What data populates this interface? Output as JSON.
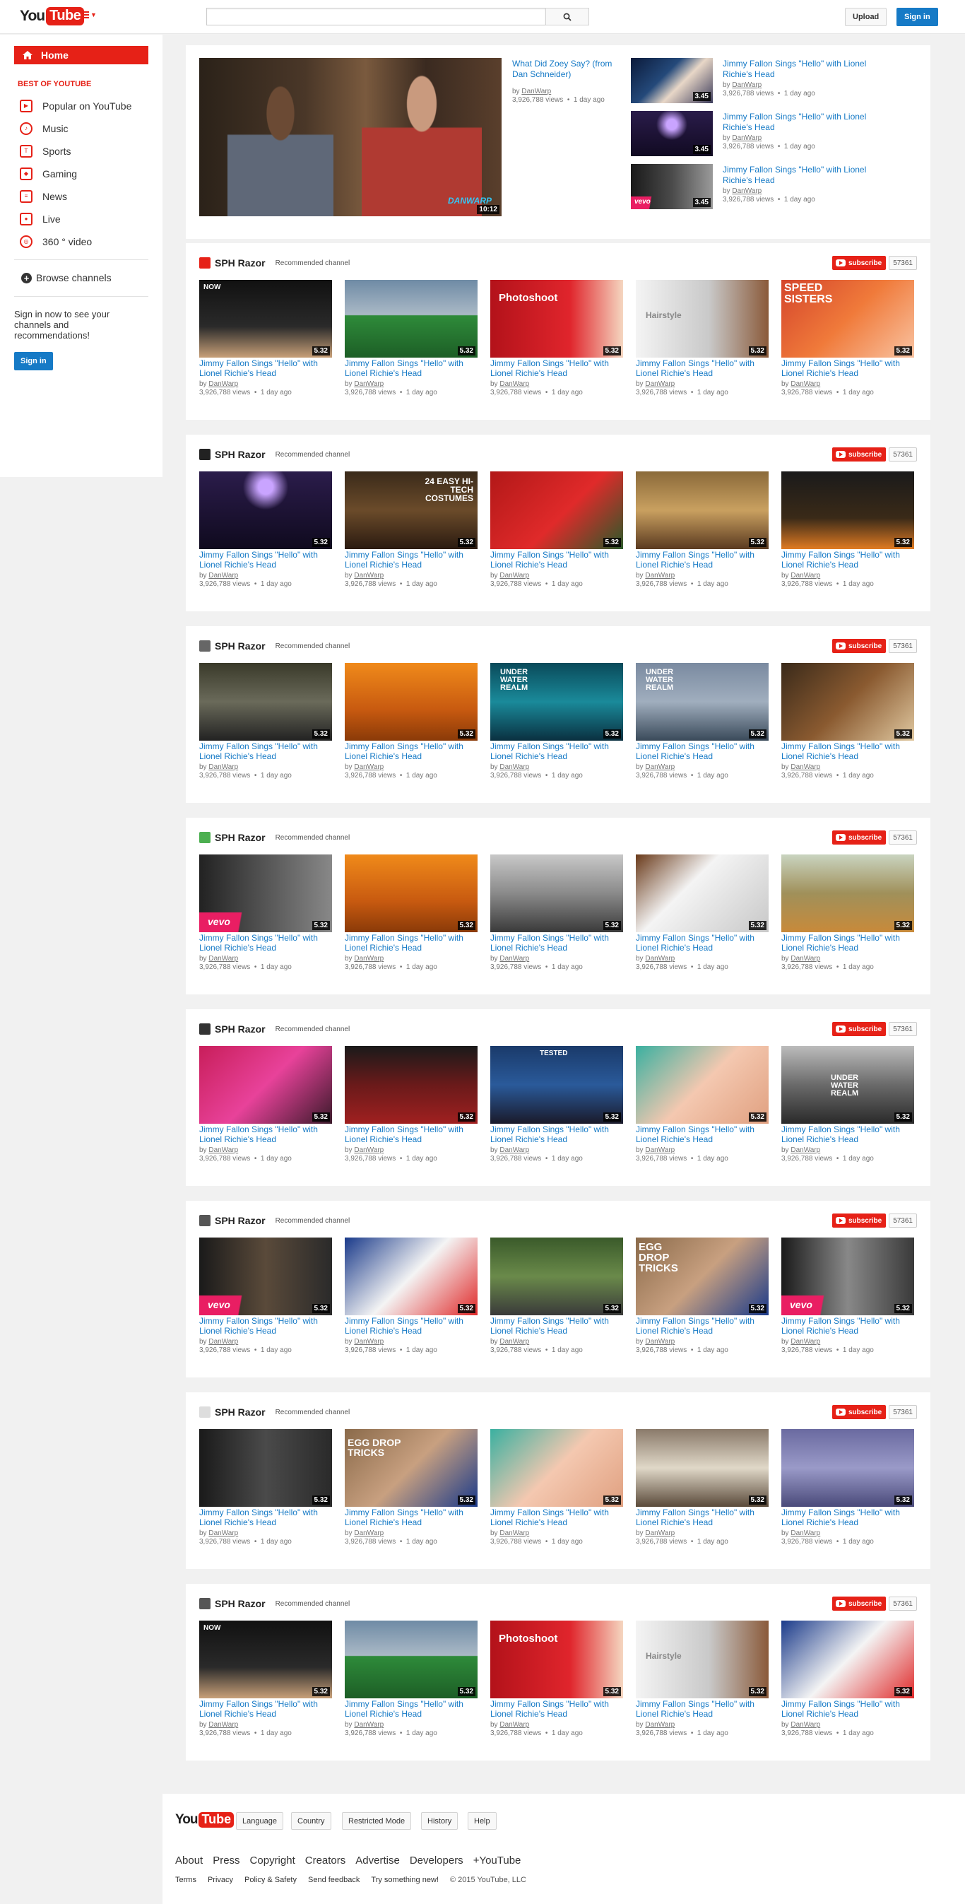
{
  "header": {
    "logo_you": "You",
    "logo_tube": "Tube",
    "search_placeholder": "",
    "upload_label": "Upload",
    "signin_label": "Sign in"
  },
  "guide": {
    "home_label": "Home",
    "section_title": "BEST OF YOUTUBE",
    "items": [
      {
        "label": "Popular on YouTube",
        "icon": "play-box-icon"
      },
      {
        "label": "Music",
        "icon": "headphones-icon"
      },
      {
        "label": "Sports",
        "icon": "trophy-icon"
      },
      {
        "label": "Gaming",
        "icon": "gamepad-icon"
      },
      {
        "label": "News",
        "icon": "newspaper-icon"
      },
      {
        "label": "Live",
        "icon": "live-icon"
      },
      {
        "label": "360 ° video",
        "icon": "360-icon"
      }
    ],
    "browse_label": "Browse channels",
    "signin_note": "Sign in now to see your channels and recommendations!",
    "signin_button": "Sign in"
  },
  "hero": {
    "title": "What Did Zoey Say? (from Dan Schneider)",
    "by_prefix": "by",
    "channel": "DanWarp",
    "views": "3,926,788 views",
    "age": "1 day ago",
    "duration": "10:12",
    "watermark": "DANWARP"
  },
  "side_videos": [
    {
      "title": "Jimmy Fallon Sings \"Hello\" with Lionel Richie's Head",
      "channel": "DanWarp",
      "views": "3,926,788 views",
      "age": "1 day ago",
      "duration": "3.45"
    },
    {
      "title": "Jimmy Fallon Sings \"Hello\" with Lionel Richie's Head",
      "channel": "DanWarp",
      "views": "3,926,788 views",
      "age": "1 day ago",
      "duration": "3.45"
    },
    {
      "title": "Jimmy Fallon Sings \"Hello\" with Lionel Richie's Head",
      "channel": "DanWarp",
      "views": "3,926,788 views",
      "age": "1 day ago",
      "duration": "3.45"
    }
  ],
  "video": {
    "title": "Jimmy Fallon Sings \"Hello\" with Lionel Richie's Head",
    "by_prefix": "by",
    "channel": "DanWarp",
    "views": "3,926,788 views",
    "age": "1 day ago",
    "duration": "5.32"
  },
  "shelf": {
    "channel_name": "SPH Razor",
    "recommended": "Recommended channel",
    "subscribe": "subscribe",
    "sub_count": "57361"
  },
  "overlays": {
    "now": "NOW",
    "photoshoot": "Photoshoot",
    "hairstyle": "Hairstyle",
    "speed_sisters": "SPEED SISTERS",
    "costumes": "24 EASY HI-TECH COSTUMES",
    "underwater": "UNDER WATER REALM",
    "vevo": "vevo",
    "egg_drop": "EGG DROP TRICKS",
    "teaser": "TESTED"
  },
  "footer": {
    "buttons": [
      "Language",
      "Country",
      "Restricted Mode",
      "History",
      "Help"
    ],
    "links": [
      "About",
      "Press",
      "Copyright",
      "Creators",
      "Advertise",
      "Developers",
      "+YouTube"
    ],
    "small_links": [
      "Terms",
      "Privacy",
      "Policy & Safety",
      "Send feedback",
      "Try something new!"
    ],
    "copyright": "© 2015 YouTube, LLC"
  }
}
